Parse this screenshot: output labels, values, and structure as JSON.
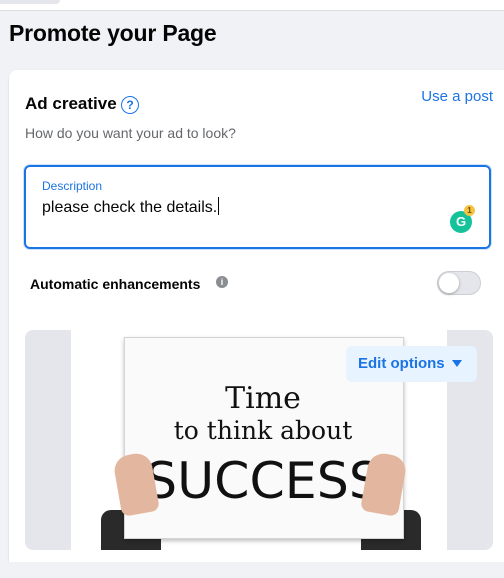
{
  "page": {
    "title": "Promote your Page"
  },
  "ad_creative": {
    "title": "Ad creative",
    "help_icon": "question-circle-icon",
    "use_post_link": "Use a post",
    "subtitle": "How do you want your ad to look?"
  },
  "description": {
    "label": "Description",
    "value": "please check the details.",
    "grammarly_letter": "G",
    "grammarly_count": "1"
  },
  "enhancements": {
    "label": "Automatic enhancements",
    "info_icon": "info-icon",
    "enabled": false
  },
  "media": {
    "edit_button": "Edit options",
    "image_text": [
      "Time",
      "to think about",
      "SUCCESS"
    ]
  },
  "colors": {
    "accent": "#1b74e4",
    "background": "#f0f2f5",
    "grammarly": "#15c39a"
  }
}
